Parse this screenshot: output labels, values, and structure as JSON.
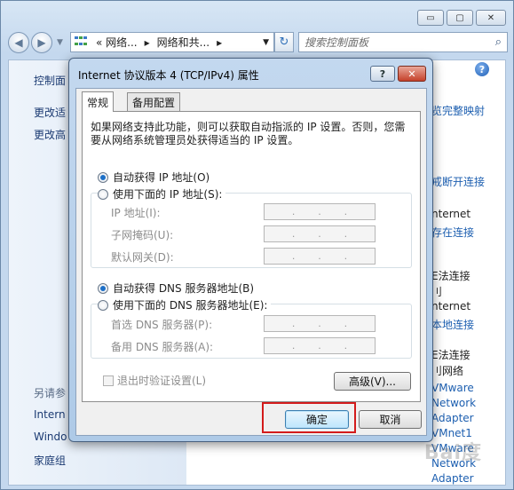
{
  "explorer": {
    "window_buttons": {
      "minimize": "▭",
      "maximize": "▢",
      "close": "✕"
    },
    "address": {
      "seg1": "« 网络...",
      "seg2": "网络和共..."
    },
    "search_placeholder": "搜索控制面板",
    "left_pane": {
      "item1": "控制面",
      "item2": "更改适",
      "item3": "更改高",
      "see_also": "另请参",
      "link1": "Intern",
      "link2": "Windo",
      "link3": "家庭组"
    },
    "right_pane": {
      "r1": "览完整映射",
      "r2": "戒断开连接",
      "r3": "nternet",
      "r4": "存在连接",
      "r5": "E法连接",
      "r6": "刂",
      "r7": "nternet",
      "r8": "本地连接",
      "r9": "E法连接",
      "r10": "刂网络",
      "r11": "VMware",
      "r12": "Network",
      "r13": "Adapter",
      "r14": "VMnet1",
      "r15": "VMware",
      "r16": "Network",
      "r17": "Adapter"
    },
    "watermark": "Bai度"
  },
  "dialog": {
    "title": "Internet 协议版本 4 (TCP/IPv4) 属性",
    "help_btn": "?",
    "close_btn": "✕",
    "tabs": [
      "常规",
      "备用配置"
    ],
    "description": "如果网络支持此功能，则可以获取自动指派的 IP 设置。否则，您需要从网络系统管理员处获得适当的 IP 设置。",
    "ip_auto": "自动获得 IP 地址(O)",
    "ip_manual": "使用下面的 IP 地址(S):",
    "ip_address_label": "IP 地址(I):",
    "subnet_label": "子网掩码(U):",
    "gateway_label": "默认网关(D):",
    "dns_auto": "自动获得 DNS 服务器地址(B)",
    "dns_manual": "使用下面的 DNS 服务器地址(E):",
    "dns_pref_label": "首选 DNS 服务器(P):",
    "dns_alt_label": "备用 DNS 服务器(A):",
    "ip_dots": ".",
    "validate_label": "退出时验证设置(L)",
    "advanced_btn": "高级(V)...",
    "ok_btn": "确定",
    "cancel_btn": "取消",
    "selected": {
      "ip_mode": "auto",
      "dns_mode": "auto",
      "validate_on_exit": false
    }
  },
  "colors": {
    "highlight": "#d31b1b",
    "link": "#1d5fb0"
  }
}
